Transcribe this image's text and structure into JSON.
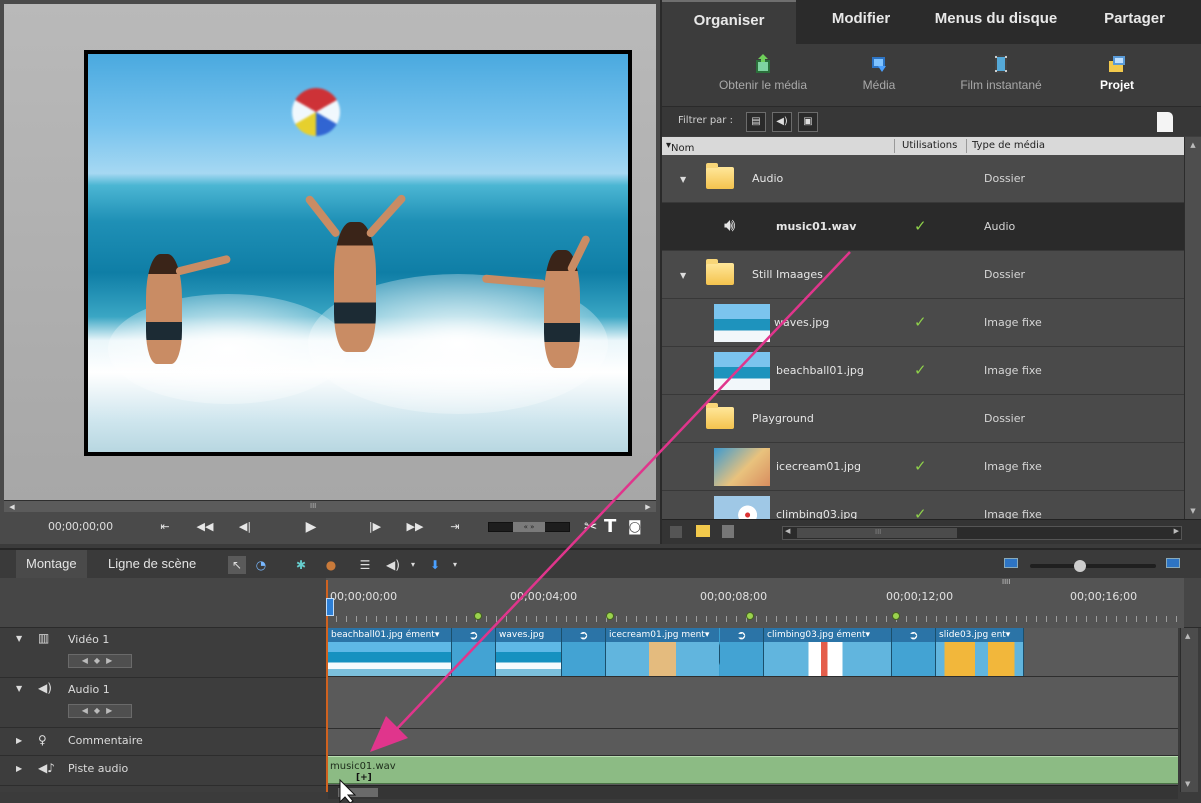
{
  "monitor": {
    "timecode": "00;00;00;00",
    "hscroll_mid": "III",
    "jog_label": "« »",
    "tool_text": "T"
  },
  "right_panel": {
    "tabs": [
      {
        "label": "Organiser",
        "active": true
      },
      {
        "label": "Modifier",
        "active": false
      },
      {
        "label": "Menus du disque",
        "active": false
      },
      {
        "label": "Partager",
        "active": false
      }
    ],
    "subtabs": [
      {
        "label": "Obtenir le média",
        "icon": "get-media-icon",
        "active": false
      },
      {
        "label": "Média",
        "icon": "media-icon",
        "active": false
      },
      {
        "label": "Film instantané",
        "icon": "instant-movie-icon",
        "active": false
      },
      {
        "label": "Projet",
        "icon": "project-icon",
        "active": true
      }
    ],
    "filter_label": "Filtrer par :",
    "columns": {
      "name": "Nom",
      "uses": "Utilisations",
      "type": "Type de média"
    },
    "rows": [
      {
        "kind": "folder",
        "name": "Audio",
        "expanded": true,
        "type": "Dossier",
        "used": false
      },
      {
        "kind": "audio",
        "name": "music01.wav",
        "type": "Audio",
        "used": true,
        "selected": true
      },
      {
        "kind": "folder",
        "name": "Still Imaages",
        "expanded": true,
        "type": "Dossier",
        "used": false
      },
      {
        "kind": "image",
        "name": "waves.jpg",
        "type": "Image fixe",
        "used": true
      },
      {
        "kind": "image",
        "name": "beachball01.jpg",
        "type": "Image fixe",
        "used": true
      },
      {
        "kind": "folder",
        "name": "Playground",
        "expanded": false,
        "type": "Dossier",
        "used": false
      },
      {
        "kind": "image",
        "name": "icecream01.jpg",
        "type": "Image fixe",
        "used": true
      },
      {
        "kind": "image",
        "name": "climbing03.jpg",
        "type": "Image fixe",
        "used": true
      }
    ],
    "hscroll_mid": "III"
  },
  "timeline": {
    "tabs": [
      {
        "label": "Montage",
        "active": true
      },
      {
        "label": "Ligne de scène",
        "active": false
      }
    ],
    "ruler_labels": [
      "00;00;00;00",
      "00;00;04;00",
      "00;00;08;00",
      "00;00;12;00",
      "00;00;16;00"
    ],
    "ruler_marker": "IIII",
    "tracks": [
      {
        "name": "Vidéo 1",
        "icon": "video-track-icon"
      },
      {
        "name": "Audio 1",
        "icon": "speaker-icon"
      },
      {
        "name": "Commentaire",
        "icon": "microphone-icon"
      },
      {
        "name": "Piste audio",
        "icon": "music-icon"
      }
    ],
    "clips": [
      {
        "label": "beachball01.jpg ément▾",
        "kind": "photo"
      },
      {
        "label": "",
        "kind": "trans"
      },
      {
        "label": "waves.jpg",
        "kind": "photo"
      },
      {
        "label": "",
        "kind": "trans"
      },
      {
        "label": "icecream01.jpg ment▾",
        "kind": "kid"
      },
      {
        "label": "",
        "kind": "trans"
      },
      {
        "label": "climbing03.jpg ément▾",
        "kind": "climb"
      },
      {
        "label": "",
        "kind": "trans"
      },
      {
        "label": "slide03.jpg ent▾",
        "kind": "slide"
      }
    ],
    "music_clip": "music01.wav",
    "music_clip_marker": "[+]"
  },
  "colors": {
    "accent_blue": "#2d74c4",
    "arrow": "#e0358c",
    "check": "#8ed04a",
    "playhead": "#d06220",
    "music_clip": "#8cbb84"
  }
}
